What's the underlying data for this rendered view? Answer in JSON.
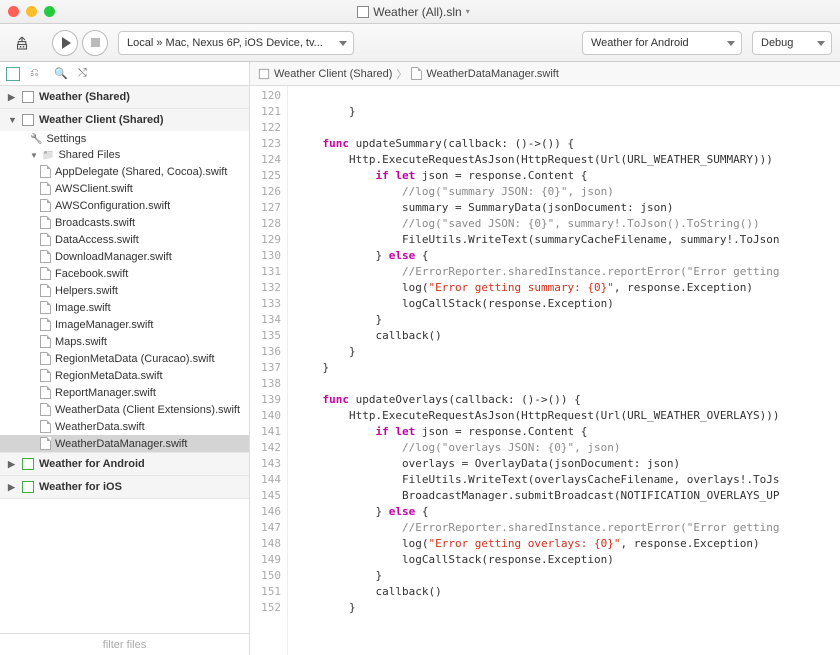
{
  "titlebar": {
    "title": "Weather (All).sln"
  },
  "toolbar": {
    "target": "Local » Mac, Nexus 6P, iOS Device, tv...",
    "config": "Weather for Android",
    "debug": "Debug"
  },
  "breadcrumb": {
    "proj": "Weather Client (Shared)",
    "file": "WeatherDataManager.swift"
  },
  "sidebar": {
    "sections": [
      {
        "label": "Weather (Shared)",
        "expanded": false
      },
      {
        "label": "Weather Client (Shared)",
        "expanded": true
      },
      {
        "label": "Weather for Android",
        "expanded": false,
        "color": "green"
      },
      {
        "label": "Weather for iOS",
        "expanded": false,
        "color": "green"
      }
    ],
    "settings": "Settings",
    "sharedFiles": "Shared Files",
    "files": [
      "AppDelegate (Shared, Cocoa).swift",
      "AWSClient.swift",
      "AWSConfiguration.swift",
      "Broadcasts.swift",
      "DataAccess.swift",
      "DownloadManager.swift",
      "Facebook.swift",
      "Helpers.swift",
      "Image.swift",
      "ImageManager.swift",
      "Maps.swift",
      "RegionMetaData (Curacao).swift",
      "RegionMetaData.swift",
      "ReportManager.swift",
      "WeatherData (Client Extensions).swift",
      "WeatherData.swift",
      "WeatherDataManager.swift"
    ],
    "filterPlaceholder": "filter files"
  },
  "code": {
    "startLine": 120,
    "lines": [
      "",
      "        }",
      "",
      "    func updateSummary(callback: ()->()) {",
      "        Http.ExecuteRequestAsJson(HttpRequest(Url(URL_WEATHER_SUMMARY)))",
      "            if let json = response.Content {",
      "                //log(\"summary JSON: {0}\", json)",
      "                summary = SummaryData(jsonDocument: json)",
      "                //log(\"saved JSON: {0}\", summary!.ToJson().ToString())",
      "                FileUtils.WriteText(summaryCacheFilename, summary!.ToJson",
      "            } else {",
      "                //ErrorReporter.sharedInstance.reportError(\"Error getting",
      "                log(\"Error getting summary: {0}\", response.Exception)",
      "                logCallStack(response.Exception)",
      "            }",
      "            callback()",
      "        }",
      "    }",
      "",
      "    func updateOverlays(callback: ()->()) {",
      "        Http.ExecuteRequestAsJson(HttpRequest(Url(URL_WEATHER_OVERLAYS)))",
      "            if let json = response.Content {",
      "                //log(\"overlays JSON: {0}\", json)",
      "                overlays = OverlayData(jsonDocument: json)",
      "                FileUtils.WriteText(overlaysCacheFilename, overlays!.ToJs",
      "                BroadcastManager.submitBroadcast(NOTIFICATION_OVERLAYS_UP",
      "            } else {",
      "                //ErrorReporter.sharedInstance.reportError(\"Error getting",
      "                log(\"Error getting overlays: {0}\", response.Exception)",
      "                logCallStack(response.Exception)",
      "            }",
      "            callback()",
      "        }"
    ]
  }
}
